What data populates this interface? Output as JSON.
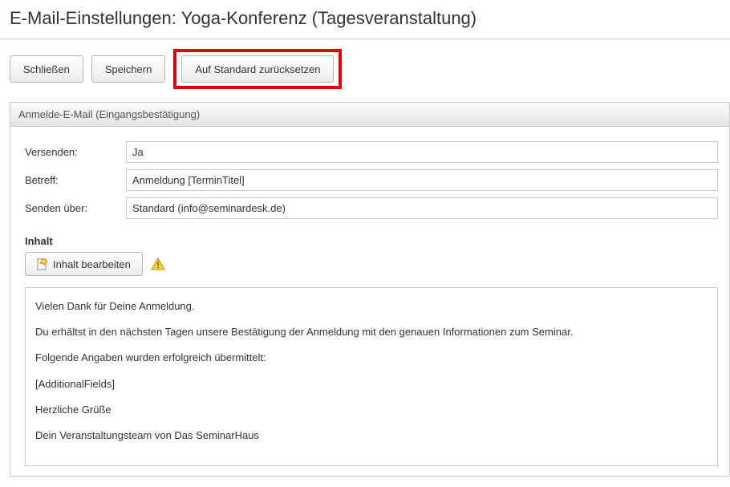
{
  "pageTitle": "E-Mail-Einstellungen: Yoga-Konferenz (Tagesveranstaltung)",
  "toolbar": {
    "close": "Schließen",
    "save": "Speichern",
    "reset": "Auf Standard zurücksetzen"
  },
  "panel": {
    "header": "Anmelde-E-Mail (Eingangsbestätigung)",
    "fields": {
      "sendLabel": "Versenden:",
      "sendValue": "Ja",
      "subjectLabel": "Betreff:",
      "subjectValue": "Anmeldung [TerminTitel]",
      "sendViaLabel": "Senden über:",
      "sendViaValue": "Standard (info@seminardesk.de)"
    },
    "content": {
      "label": "Inhalt",
      "editButton": "Inhalt bearbeiten",
      "body": {
        "p1": "Vielen Dank für Deine Anmeldung.",
        "p2": "Du erhältst in den nächsten Tagen unsere Bestätigung der Anmeldung mit den genauen Informationen zum Seminar.",
        "p3": "Folgende Angaben wurden erfolgreich übermittelt:",
        "p4": "[AdditionalFields]",
        "p5": "Herzliche Grüße",
        "p6": "Dein Veranstaltungsteam von Das SeminarHaus"
      }
    }
  }
}
